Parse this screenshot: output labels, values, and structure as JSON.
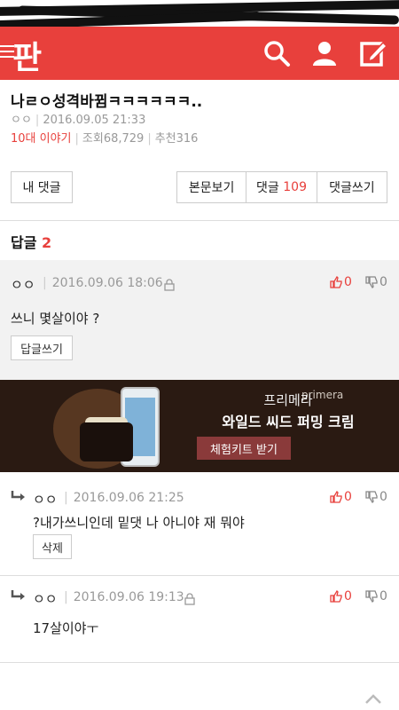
{
  "header": {
    "logo": "판",
    "icons": [
      "menu-icon",
      "search-icon",
      "user-icon",
      "write-icon"
    ],
    "color": "#e8403c"
  },
  "post": {
    "title": "나ㄹㅇ성격바뀜ㅋㅋㅋㅋㅋㅋ..",
    "author": "ㅇㅇ",
    "date": "2016.09.05 21:33",
    "category": "10대 이야기",
    "views_label": "조회",
    "views": "68,729",
    "recommend_label": "추천",
    "recommend": "316"
  },
  "actions": {
    "my_comments": "내 댓글",
    "view_body": "본문보기",
    "comments_label": "댓글",
    "comments_count": "109",
    "write_comment": "댓글쓰기"
  },
  "replies": {
    "heading": "답글",
    "count": "2"
  },
  "parent_comment": {
    "author": "ㅇㅇ",
    "date": "2016.09.06 18:06",
    "up": "0",
    "down": "0",
    "body": "쓰니 몇살이야 ?",
    "reply_button": "답글쓰기"
  },
  "ad": {
    "brand": "primera",
    "line1": "프리메라",
    "line2": "와일드 씨드 퍼밍 크림",
    "cta": "체험키트 받기"
  },
  "reply_items": [
    {
      "author": "ㅇㅇ",
      "date": "2016.09.06 21:25",
      "up": "0",
      "down": "0",
      "body": "?내가쓰니인데 밑댓 나 아니야 재 뭐야",
      "button": "삭제"
    },
    {
      "author": "ㅇㅇ",
      "date": "2016.09.06 19:13",
      "up": "0",
      "down": "0",
      "body": "17살이야ㅜ"
    }
  ]
}
